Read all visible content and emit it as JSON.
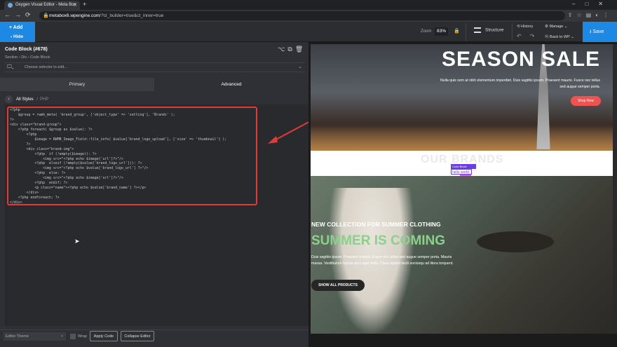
{
  "browser": {
    "tab_title": "Oxygen Visual Editor - Meta Box",
    "url_domain": "metabox6.wpengine.com",
    "url_path": "/?ct_builder=true&ct_inner=true"
  },
  "toolbar": {
    "add_label": "+ Add",
    "hide_label": "‹ Hide",
    "zoom_label": "Zoom",
    "zoom_value": "83%",
    "structure_label": "Structure",
    "history_label": "History",
    "manage_label": "Manage",
    "back_to_wp_label": "Back to WP",
    "save_label": "Save"
  },
  "panel": {
    "title": "Code Block (#678)",
    "breadcrumb": "Section › Div › Code Block",
    "selector_placeholder": "Choose selector to edit...",
    "tabs": [
      "Primary",
      "Advanced"
    ],
    "styles_label": "All Styles",
    "php_label": "PHP",
    "code_lines": [
      "<?php",
      "    $group = rwmb_meta( 'brand_group', ['object_type' => 'setting'], 'Brands' );",
      "?>",
      "<div class=\"brand-group\">",
      "    <?php foreach( $group as $value): ?>",
      "        <?php",
      "            $image = RWMB_Image_Field::file_info( $value['brand_logo_upload'], ['size' => 'thumbnail'] );",
      "        ?>",
      "        <div class=\"brand-img\">",
      "            <?php  if (!empty($image)): ?>",
      "                <img src=\"<?php echo $image['url']?>\"/>",
      "            <?php  elseif (!empty($value['brand_logo_url'])): ?>",
      "                <img src=\"<?php echo $value['brand_logo_url'] ?>\"/>",
      "            <?php  else: ?>",
      "                <img src=\"<?php echo $image['url']?>\"/>",
      "            <?php  endif; ?>",
      "            <p class=\"name\"><?php echo $value['brand_name'] ?></p>",
      "        </div>",
      "    <?php endforeach; ?>",
      "</div>"
    ],
    "editor_theme": "Editor Theme",
    "wrap_label": "Wrap",
    "apply_code": "Apply Code",
    "collapse_editor": "Collapse Editor"
  },
  "canvas": {
    "hero_title": "SEASON SALE",
    "hero_text": "Nulla quis sem at nibh elementum imperdiet. Duis sagittis ipsum. Praesent mauris. Fusce nec tellus sed augue semper porta.",
    "shop_now": "Shop Now",
    "brands_title": "OUR BRANDS",
    "code_tag": "Code Block",
    "hello_text": "hello world",
    "new_collection": "NEW COLLECTION FOR SUMMER CLOTHING",
    "summer_title": "SUMMER IS COMING",
    "summer_text": "Duis sagittis ipsum. Praesent mauris. Fusce nec tellus sed augue semper porta. Mauris massa. Vestibulum lacinia arcu eget nulla. Class aptent taciti sociosqu ad litora torquent.",
    "show_all": "SHOW ALL PRODUCTS"
  },
  "colors": {
    "accent": "#1e88e5",
    "highlight_box": "#e53935",
    "shop_button": "#ef5350",
    "summer_green": "#8bd08b",
    "code_tag": "#6a3fe0"
  }
}
